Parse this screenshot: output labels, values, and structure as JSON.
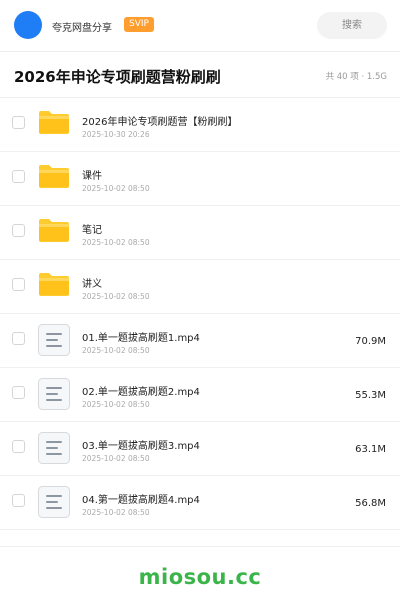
{
  "header": {
    "app_name": "夸克网盘分享",
    "badge": "SVIP",
    "search_placeholder": "搜索",
    "avatar_color": "#1f7ef6",
    "badge_color": "#ff9d2e"
  },
  "title_bar": {
    "title": "2026年申论专项刷题营粉刷刷",
    "meta": "共 40 项 · 1.5G"
  },
  "files": [
    {
      "type": "folder",
      "icon": "folder-icon",
      "name": "2026年申论专项刷题营【粉刷刷】",
      "date": "2025-10-30 20:26",
      "size": ""
    },
    {
      "type": "folder",
      "icon": "folder-icon",
      "name": "课件",
      "date": "2025-10-02 08:50",
      "size": ""
    },
    {
      "type": "folder",
      "icon": "folder-icon",
      "name": "笔记",
      "date": "2025-10-02 08:50",
      "size": ""
    },
    {
      "type": "folder",
      "icon": "folder-icon",
      "name": "讲义",
      "date": "2025-10-02 08:50",
      "size": ""
    },
    {
      "type": "file",
      "icon": "document-icon",
      "name": "01.单一题拔高刷题1.mp4",
      "date": "2025-10-02 08:50",
      "size": "70.9M"
    },
    {
      "type": "file",
      "icon": "document-icon",
      "name": "02.单一题拔高刷题2.mp4",
      "date": "2025-10-02 08:50",
      "size": "55.3M"
    },
    {
      "type": "file",
      "icon": "document-icon",
      "name": "03.单一题拔高刷题3.mp4",
      "date": "2025-10-02 08:50",
      "size": "63.1M"
    },
    {
      "type": "file",
      "icon": "document-icon",
      "name": "04.第一题拔高刷题4.mp4",
      "date": "2025-10-02 08:50",
      "size": "56.8M"
    }
  ],
  "watermark": {
    "text": "miosou.cc",
    "color": "#3bb54a"
  }
}
